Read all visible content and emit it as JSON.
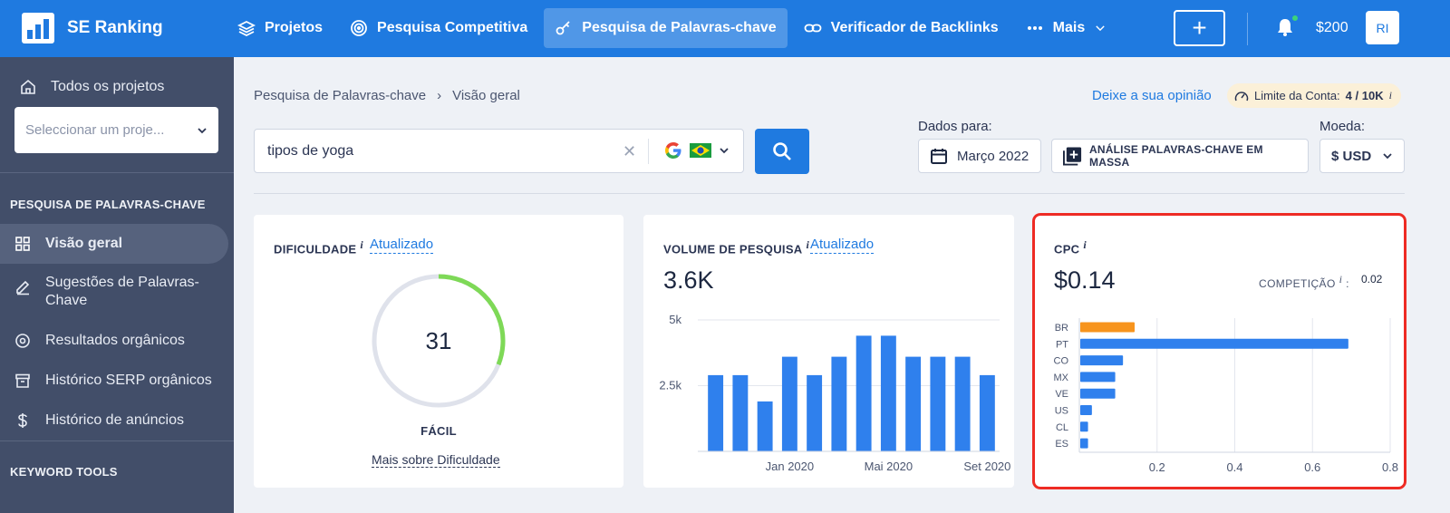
{
  "app": {
    "name": "SE Ranking",
    "nav": [
      {
        "label": "Projetos",
        "icon": "layers-icon"
      },
      {
        "label": "Pesquisa Competitiva",
        "icon": "target-icon"
      },
      {
        "label": "Pesquisa de Palavras-chave",
        "icon": "key-icon",
        "active": true
      },
      {
        "label": "Verificador de Backlinks",
        "icon": "link-icon"
      },
      {
        "label": "Mais",
        "icon": "more-dots-icon"
      }
    ],
    "plus_label": "+",
    "balance": "$200",
    "avatar": "RI",
    "accent": "#1f7ae0"
  },
  "sidebar": {
    "all_projects": "Todos os projetos",
    "project_placeholder": "Seleccionar um proje...",
    "section1": "PESQUISA DE PALAVRAS-CHAVE",
    "items": [
      {
        "label": "Visão geral",
        "icon": "grid-icon",
        "active": true
      },
      {
        "label": "Sugestões de Palavras-Chave",
        "icon": "pencil-icon"
      },
      {
        "label": "Resultados orgânicos",
        "icon": "target-icon"
      },
      {
        "label": "Histórico SERP orgânicos",
        "icon": "archive-icon"
      },
      {
        "label": "Histórico de anúncios",
        "icon": "dollar-icon"
      }
    ],
    "section2": "KEYWORD TOOLS"
  },
  "header": {
    "breadcrumb": [
      "Pesquisa de Palavras-chave",
      "Visão geral"
    ],
    "feedback": "Deixe a sua opinião",
    "limit_label": "Limite da Conta:",
    "limit_value": "4 / 10K",
    "info": "i"
  },
  "search": {
    "query": "tipos de yoga",
    "engine": "google-icon",
    "country": "brazil-flag-icon"
  },
  "controls": {
    "data_label": "Dados para:",
    "date": "Março 2022",
    "bulk": "ANÁLISE PALAVRAS-CHAVE EM MASSA",
    "currency_label": "Moeda:",
    "currency": "$ USD"
  },
  "difficulty": {
    "title": "DIFICULDADE",
    "updated": "Atualizado",
    "value": 31,
    "level": "FÁCIL",
    "more": "Mais sobre Dificuldade",
    "color": "#7ed957"
  },
  "volume": {
    "title": "VOLUME DE PESQUISA",
    "updated": "Atualizado",
    "value": "3.6K"
  },
  "cpc": {
    "title": "CPC",
    "value": "$0.14",
    "competition_label": "COMPETIÇÃO",
    "competition_value": "0.02"
  },
  "chart_data": [
    {
      "type": "bar",
      "categories": [
        "",
        "",
        "",
        "Jan 2020",
        "",
        "",
        "",
        "Mai 2020",
        "",
        "",
        "",
        "Set 2020"
      ],
      "values": [
        2900,
        2900,
        1900,
        3600,
        2900,
        3600,
        4400,
        4400,
        3600,
        3600,
        3600,
        2900
      ],
      "yticks": [
        "2.5k",
        "5k"
      ],
      "ylim": [
        0,
        5000
      ],
      "color": "#2f80ed"
    },
    {
      "type": "bar",
      "orientation": "horizontal",
      "categories": [
        "BR",
        "PT",
        "CO",
        "MX",
        "VE",
        "US",
        "CL",
        "ES"
      ],
      "values": [
        0.14,
        0.69,
        0.11,
        0.09,
        0.09,
        0.03,
        0.02,
        0.02
      ],
      "xticks": [
        "0.2",
        "0.4",
        "0.6",
        "0.8"
      ],
      "xlim": [
        0,
        0.8
      ],
      "colors": {
        "BR": "#f7941d",
        "default": "#2f80ed"
      }
    }
  ]
}
